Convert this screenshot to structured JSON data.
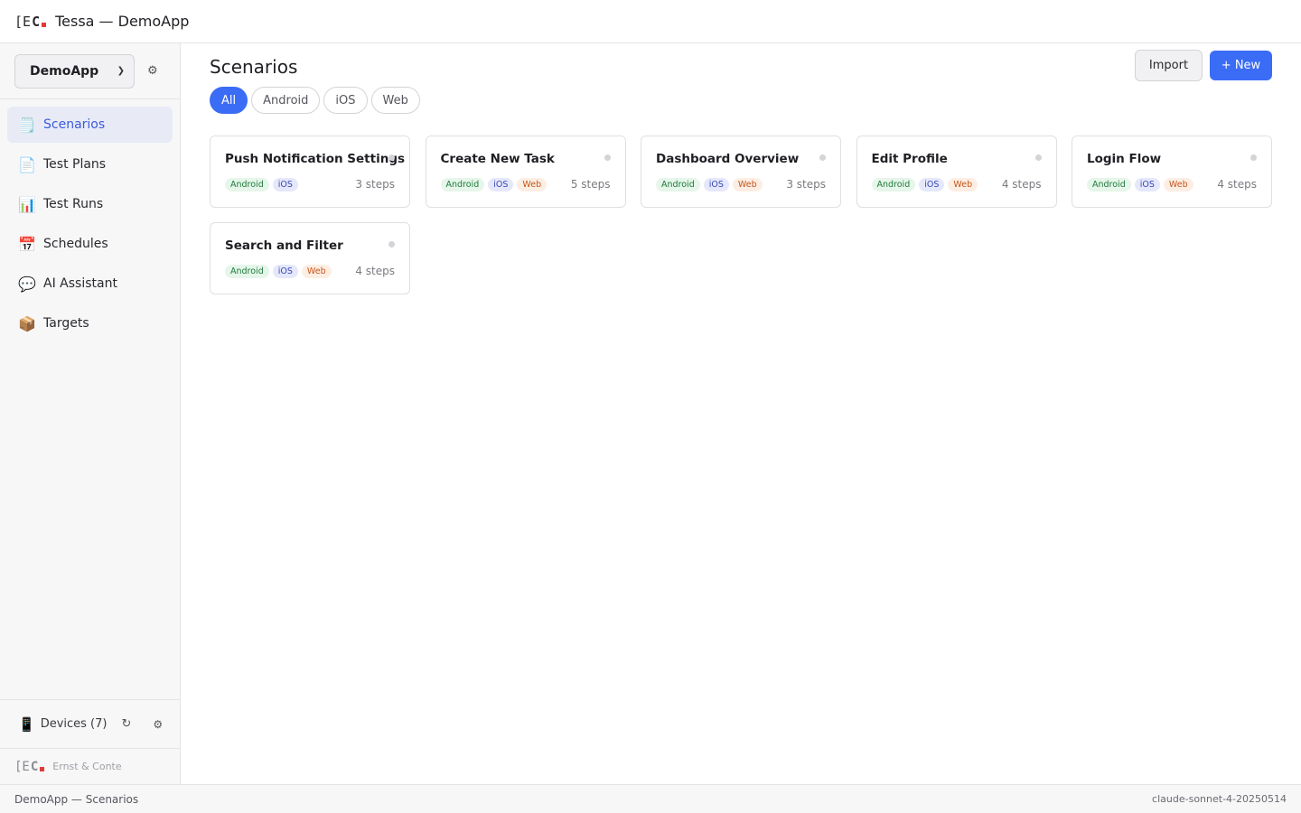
{
  "header": {
    "logo_left": "[E",
    "logo_c": "C",
    "title": "Tessa — DemoApp"
  },
  "sidebar": {
    "project": "DemoApp",
    "items": [
      {
        "label": "Scenarios",
        "icon": "notepad-icon",
        "glyph": "🗒️",
        "active": true
      },
      {
        "label": "Test Plans",
        "icon": "document-icon",
        "glyph": "📄",
        "active": false
      },
      {
        "label": "Test Runs",
        "icon": "bar-chart-icon",
        "glyph": "📊",
        "active": false
      },
      {
        "label": "Schedules",
        "icon": "calendar-icon",
        "glyph": "📅",
        "active": false
      },
      {
        "label": "AI Assistant",
        "icon": "speech-bubble-icon",
        "glyph": "💬",
        "active": false
      },
      {
        "label": "Targets",
        "icon": "package-icon",
        "glyph": "📦",
        "active": false
      }
    ],
    "devices_label": "Devices (7)",
    "company": "Ernst & Conte"
  },
  "main": {
    "title": "Scenarios",
    "import_label": "Import",
    "new_label": "+ New",
    "filters": [
      {
        "label": "All",
        "active": true
      },
      {
        "label": "Android",
        "active": false
      },
      {
        "label": "iOS",
        "active": false
      },
      {
        "label": "Web",
        "active": false
      }
    ],
    "scenarios": [
      {
        "title": "Push Notification Settings",
        "tags": [
          "Android",
          "iOS"
        ],
        "steps": "3 steps"
      },
      {
        "title": "Create New Task",
        "tags": [
          "Android",
          "iOS",
          "Web"
        ],
        "steps": "5 steps"
      },
      {
        "title": "Dashboard Overview",
        "tags": [
          "Android",
          "iOS",
          "Web"
        ],
        "steps": "3 steps"
      },
      {
        "title": "Edit Profile",
        "tags": [
          "Android",
          "iOS",
          "Web"
        ],
        "steps": "4 steps"
      },
      {
        "title": "Login Flow",
        "tags": [
          "Android",
          "iOS",
          "Web"
        ],
        "steps": "4 steps"
      },
      {
        "title": "Search and Filter",
        "tags": [
          "Android",
          "iOS",
          "Web"
        ],
        "steps": "4 steps"
      }
    ]
  },
  "statusbar": {
    "left": "DemoApp — Scenarios",
    "right": "claude-sonnet-4-20250514"
  },
  "colors": {
    "accent": "#3b6cf6",
    "android": "#1f7a3a",
    "ios": "#3a47b8",
    "web": "#c4561a"
  }
}
